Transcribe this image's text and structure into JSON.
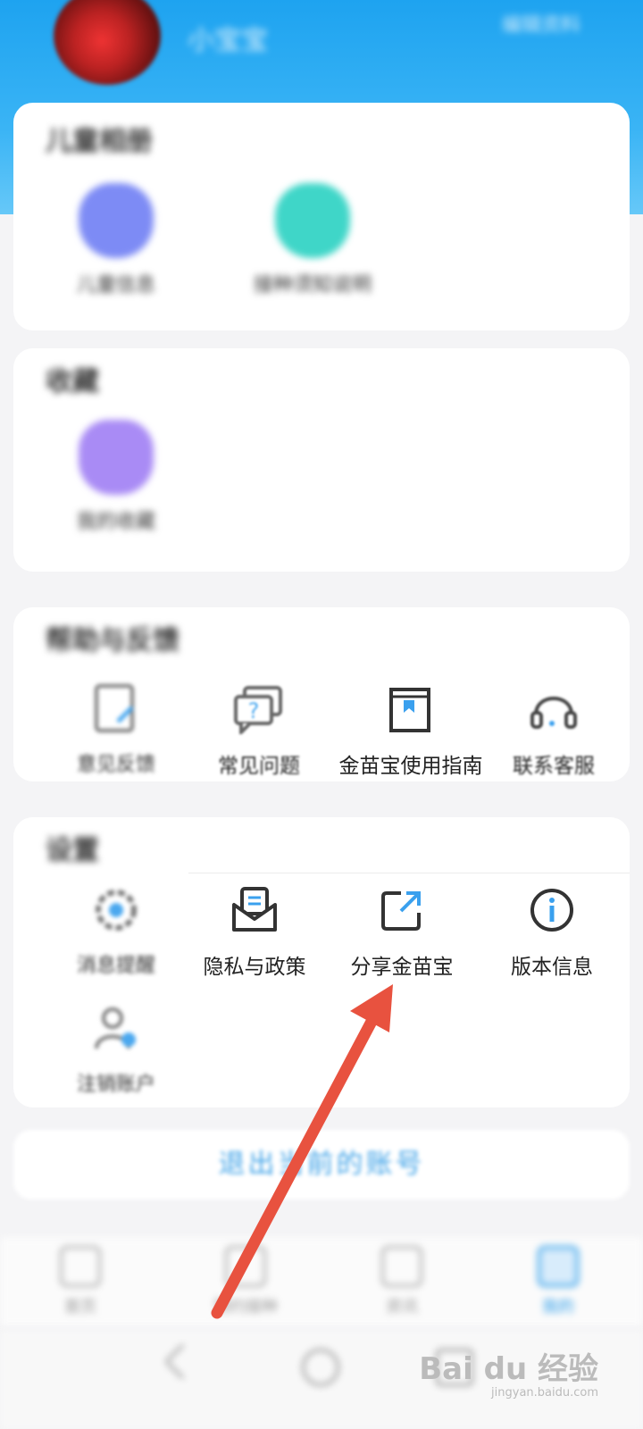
{
  "header": {
    "username": "小宝宝",
    "right_text": "编辑资料"
  },
  "card_children": {
    "title": "儿童相册",
    "items": [
      {
        "label": "儿童信息",
        "icon": "child-profile-icon",
        "color": "#7d8bf5"
      },
      {
        "label": "接种须知说明",
        "icon": "vaccine-notes-icon",
        "color": "#3fd6c8"
      }
    ]
  },
  "card_collect": {
    "title": "收藏",
    "items": [
      {
        "label": "我的收藏",
        "icon": "favorites-star-icon",
        "color": "#a98bf5"
      }
    ]
  },
  "card_help": {
    "title": "帮助与反馈",
    "items": [
      {
        "label": "意见反馈",
        "icon": "feedback-icon",
        "blurred": true
      },
      {
        "label": "常见问题",
        "icon": "faq-chat-icon"
      },
      {
        "label": "金苗宝使用指南",
        "icon": "user-guide-book-icon"
      },
      {
        "label": "联系客服",
        "icon": "headset-icon"
      }
    ]
  },
  "card_settings": {
    "title": "设置",
    "items": [
      {
        "label": "消息提醒",
        "icon": "gear-icon",
        "blurred": true
      },
      {
        "label": "隐私与政策",
        "icon": "privacy-policy-icon"
      },
      {
        "label": "分享金苗宝",
        "icon": "share-icon"
      },
      {
        "label": "版本信息",
        "icon": "info-icon"
      },
      {
        "label": "注销账户",
        "icon": "account-cancel-icon",
        "blurred": true
      }
    ]
  },
  "logout": {
    "label": "退出当前的账号"
  },
  "tabbar": [
    {
      "label": "首页",
      "icon": "home-icon"
    },
    {
      "label": "预约接种",
      "icon": "appointment-icon"
    },
    {
      "label": "资讯",
      "icon": "news-icon"
    },
    {
      "label": "我的",
      "icon": "profile-icon",
      "active": true
    }
  ],
  "watermark": {
    "logo": "Bai du 经验",
    "url": "jingyan.baidu.com"
  },
  "colors": {
    "primary": "#1ea3f0",
    "arrow": "#e8523f",
    "link": "#45a5e8"
  }
}
